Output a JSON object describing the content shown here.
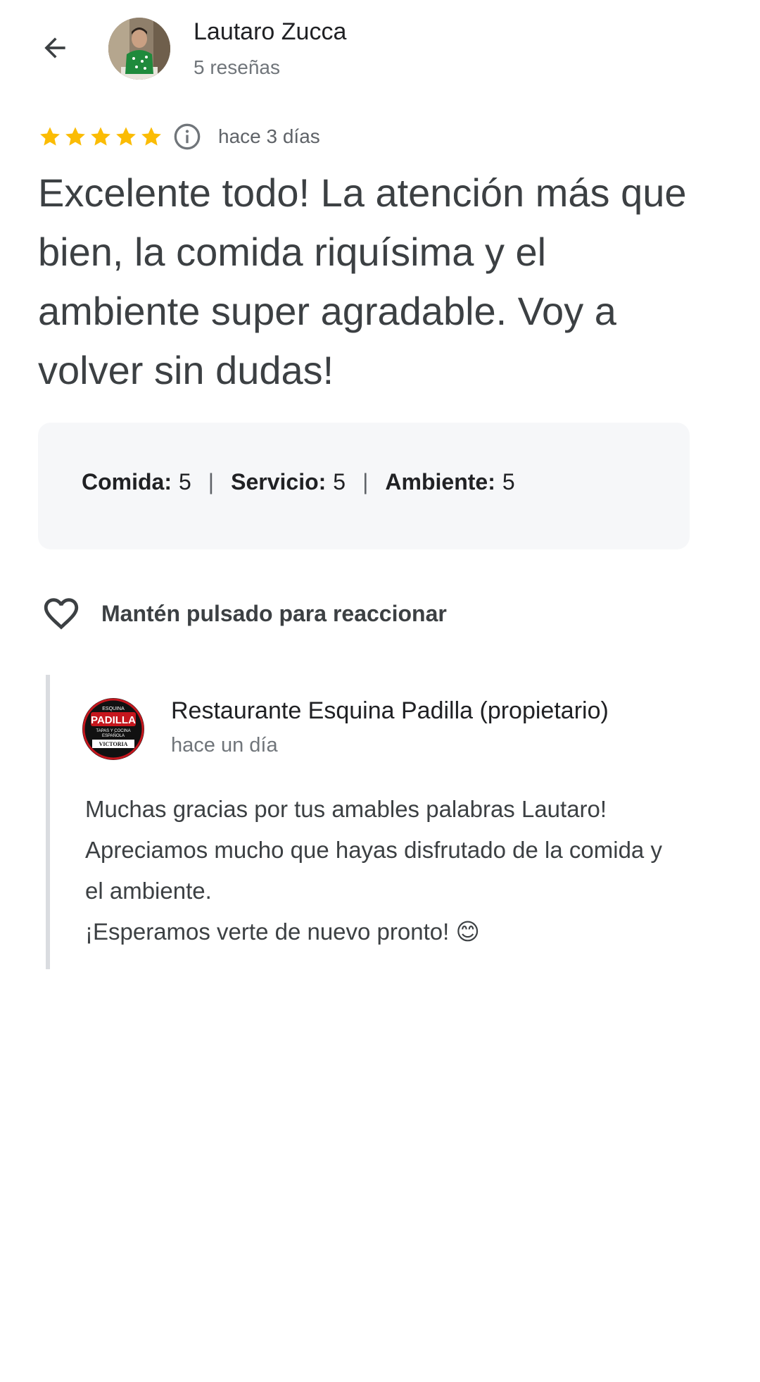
{
  "header": {
    "reviewer_name": "Lautaro Zucca",
    "reviewer_review_count": "5 reseñas",
    "back_icon": "arrow-back-icon"
  },
  "review": {
    "rating_stars": 5,
    "date": "hace 3 días",
    "text": "Excelente todo! La atención más que bien, la comida riquísima y el ambiente super agradable. Voy a volver sin dudas!",
    "scores": [
      {
        "label": "Comida:",
        "value": "5"
      },
      {
        "label": "Servicio:",
        "value": "5"
      },
      {
        "label": "Ambiente:",
        "value": "5"
      }
    ],
    "score_separator": "|"
  },
  "reaction": {
    "label": "Mantén pulsado para reaccionar",
    "icon": "heart-outline-icon"
  },
  "owner_reply": {
    "name": "Restaurante Esquina Padilla (propietario)",
    "date": "hace un día",
    "lines": [
      "Muchas gracias por tus amables palabras Lautaro!",
      "Apreciamos mucho que hayas disfrutado de la comida y",
      "el ambiente.",
      "¡Esperamos verte de nuevo pronto! 😊"
    ],
    "logo_text": [
      "ESQUINA",
      "PADILLA",
      "TAPAS Y COCINA",
      "ESPAÑOLA",
      "VICTORIA"
    ]
  },
  "colors": {
    "star": "#fbbc04",
    "text_primary": "#202124",
    "text_body": "#3c4043",
    "text_secondary": "#70757a",
    "card_bg": "#f6f7f9",
    "divider": "#dadce0",
    "logo_red": "#c5161d"
  }
}
